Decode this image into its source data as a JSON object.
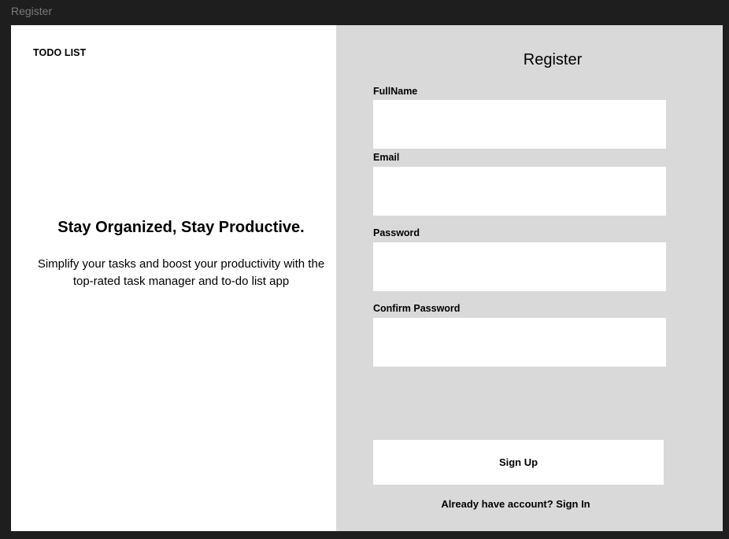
{
  "window": {
    "frame_label": "Register"
  },
  "left": {
    "brand": "TODO LIST",
    "headline": "Stay Organized, Stay Productive.",
    "subline": "Simplify your tasks and boost your productivity with the top-rated task manager and to-do list app"
  },
  "form": {
    "title": "Register",
    "fields": [
      {
        "label": "FullName",
        "value": "",
        "placeholder": ""
      },
      {
        "label": "Email",
        "value": "",
        "placeholder": ""
      },
      {
        "label": "Password",
        "value": "",
        "placeholder": ""
      },
      {
        "label": "Confirm Password",
        "value": "",
        "placeholder": ""
      }
    ],
    "submit_label": "Sign Up",
    "signin_prompt": "Already have account?",
    "signin_link": "Sign In"
  },
  "colors": {
    "canvas": "#1e1e1e",
    "left_panel": "#ffffff",
    "right_panel": "#d9d9d9",
    "input_bg": "#ffffff",
    "text": "#000000"
  }
}
